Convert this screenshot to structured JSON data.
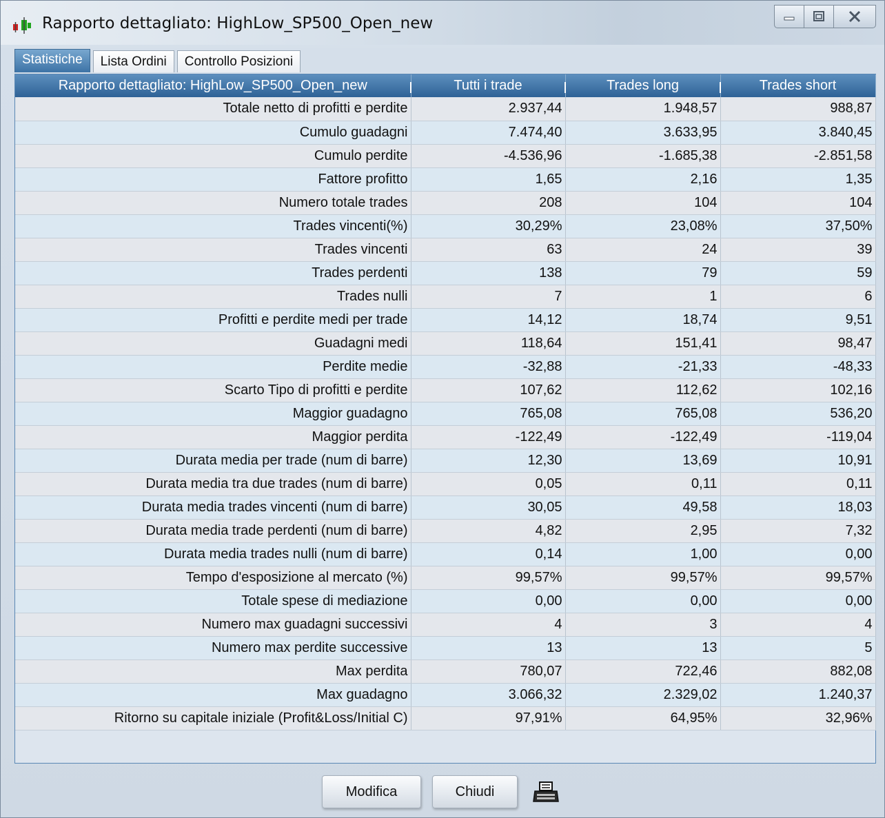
{
  "window": {
    "title": "Rapporto dettagliato: HighLow_SP500_Open_new"
  },
  "tabs": [
    {
      "label": "Statistiche",
      "active": true
    },
    {
      "label": "Lista Ordini",
      "active": false
    },
    {
      "label": "Controllo Posizioni",
      "active": false
    }
  ],
  "table": {
    "headers": [
      "Rapporto dettagliato: HighLow_SP500_Open_new",
      "Tutti i trade",
      "Trades long",
      "Trades short"
    ],
    "rows": [
      [
        "Totale netto di profitti e perdite",
        "2.937,44",
        "1.948,57",
        "988,87"
      ],
      [
        "Cumulo guadagni",
        "7.474,40",
        "3.633,95",
        "3.840,45"
      ],
      [
        "Cumulo perdite",
        "-4.536,96",
        "-1.685,38",
        "-2.851,58"
      ],
      [
        "Fattore profitto",
        "1,65",
        "2,16",
        "1,35"
      ],
      [
        "Numero totale trades",
        "208",
        "104",
        "104"
      ],
      [
        "Trades vincenti(%)",
        "30,29%",
        "23,08%",
        "37,50%"
      ],
      [
        "Trades vincenti",
        "63",
        "24",
        "39"
      ],
      [
        "Trades perdenti",
        "138",
        "79",
        "59"
      ],
      [
        "Trades nulli",
        "7",
        "1",
        "6"
      ],
      [
        "Profitti e perdite medi per trade",
        "14,12",
        "18,74",
        "9,51"
      ],
      [
        "Guadagni medi",
        "118,64",
        "151,41",
        "98,47"
      ],
      [
        "Perdite medie",
        "-32,88",
        "-21,33",
        "-48,33"
      ],
      [
        "Scarto Tipo di profitti e perdite",
        "107,62",
        "112,62",
        "102,16"
      ],
      [
        "Maggior guadagno",
        "765,08",
        "765,08",
        "536,20"
      ],
      [
        "Maggior perdita",
        "-122,49",
        "-122,49",
        "-119,04"
      ],
      [
        "Durata media per trade (num di barre)",
        "12,30",
        "13,69",
        "10,91"
      ],
      [
        "Durata media tra due trades (num di barre)",
        "0,05",
        "0,11",
        "0,11"
      ],
      [
        "Durata media trades vincenti (num di barre)",
        "30,05",
        "49,58",
        "18,03"
      ],
      [
        "Durata media trade perdenti (num di barre)",
        "4,82",
        "2,95",
        "7,32"
      ],
      [
        "Durata media trades nulli (num di barre)",
        "0,14",
        "1,00",
        "0,00"
      ],
      [
        "Tempo d'esposizione al mercato (%)",
        "99,57%",
        "99,57%",
        "99,57%"
      ],
      [
        "Totale spese di mediazione",
        "0,00",
        "0,00",
        "0,00"
      ],
      [
        "Numero max guadagni successivi",
        "4",
        "3",
        "4"
      ],
      [
        "Numero max perdite successive",
        "13",
        "13",
        "5"
      ],
      [
        "Max perdita",
        "780,07",
        "722,46",
        "882,08"
      ],
      [
        "Max guadagno",
        "3.066,32",
        "2.329,02",
        "1.240,37"
      ],
      [
        "Ritorno su capitale iniziale (Profit&Loss/Initial C)",
        "97,91%",
        "64,95%",
        "32,96%"
      ]
    ]
  },
  "buttons": {
    "modifica": "Modifica",
    "chiudi": "Chiudi"
  },
  "icons": {
    "app": "chart-candles-icon",
    "print": "printer-icon",
    "minimize": "minimize-icon",
    "maximize": "maximize-icon",
    "close": "close-icon"
  }
}
